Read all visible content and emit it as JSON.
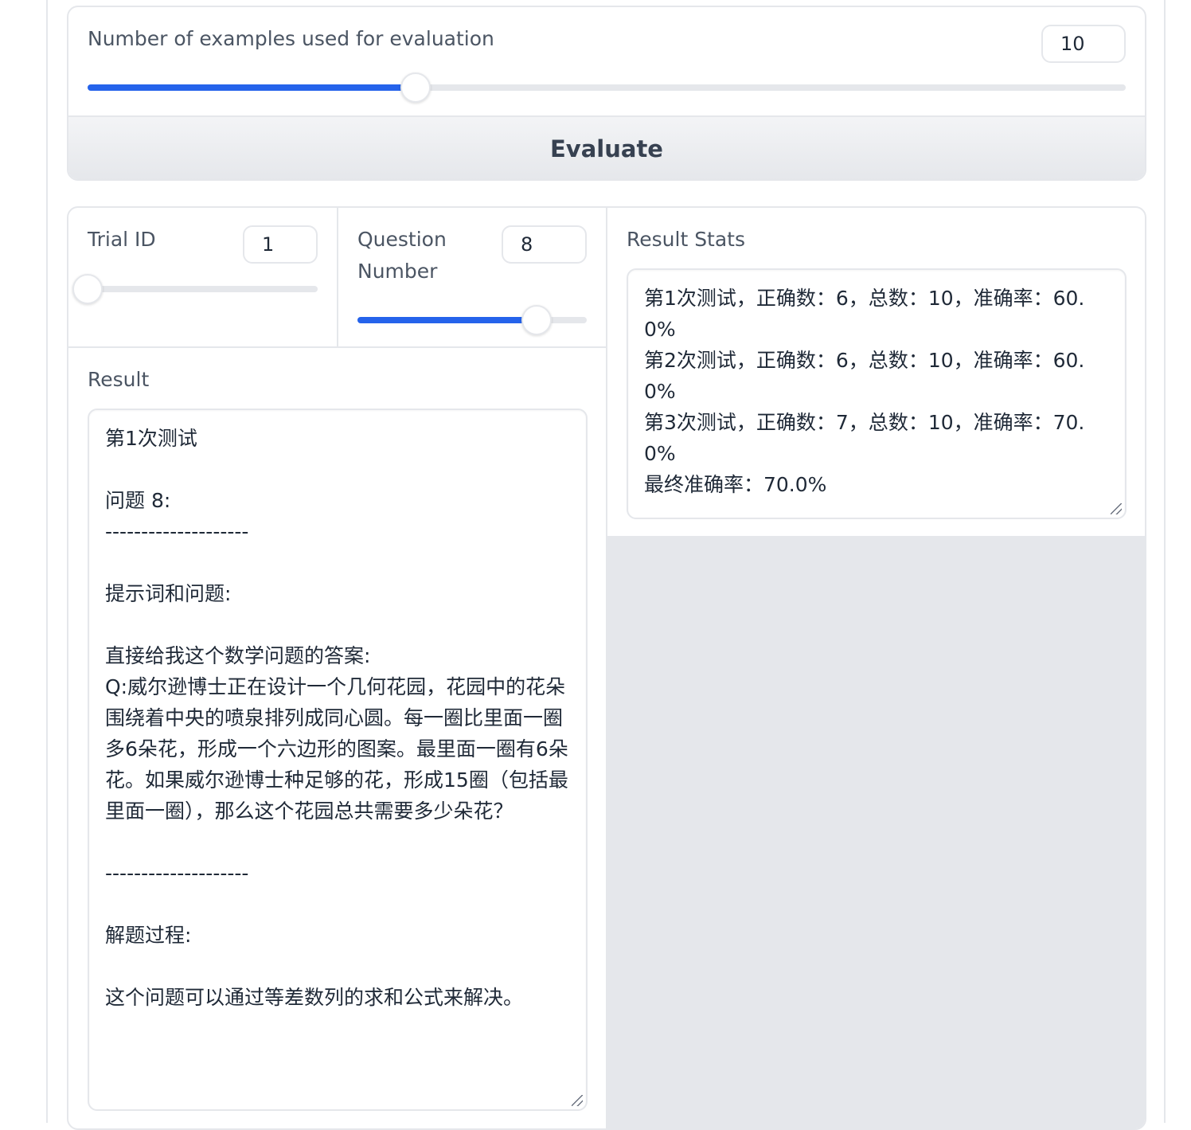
{
  "evaluation": {
    "examples_label": "Number of examples used for evaluation",
    "examples_value": "10",
    "examples_slider_fraction": 0.316,
    "evaluate_button": "Evaluate"
  },
  "trial": {
    "label": "Trial ID",
    "value": "1",
    "slider_fraction": 0.0
  },
  "question": {
    "label_line1": "Question",
    "label_line2": "Number",
    "value": "8",
    "slider_fraction": 0.78
  },
  "result": {
    "label": "Result",
    "text": "第1次测试\n\n问题 8:\n--------------------\n\n提示词和问题:\n\n直接给我这个数学问题的答案:\nQ:威尔逊博士正在设计一个几何花园，花园中的花朵围绕着中央的喷泉排列成同心圆。每一圈比里面一圈多6朵花，形成一个六边形的图案。最里面一圈有6朵花。如果威尔逊博士种足够的花，形成15圈（包括最里面一圈），那么这个花园总共需要多少朵花？\n\n--------------------\n\n解题过程:\n\n这个问题可以通过等差数列的求和公式来解决。"
  },
  "result_stats": {
    "label": "Result Stats",
    "text": "第1次测试，正确数：6，总数：10，准确率：60.0%\n第2次测试，正确数：6，总数：10，准确率：60.0%\n第3次测试，正确数：7，总数：10，准确率：70.0%\n最终准确率：70.0%"
  },
  "colors": {
    "accent": "#2563eb",
    "border": "#e5e7eb",
    "label": "#4b5563",
    "panel_bg": "#e5e7eb"
  }
}
